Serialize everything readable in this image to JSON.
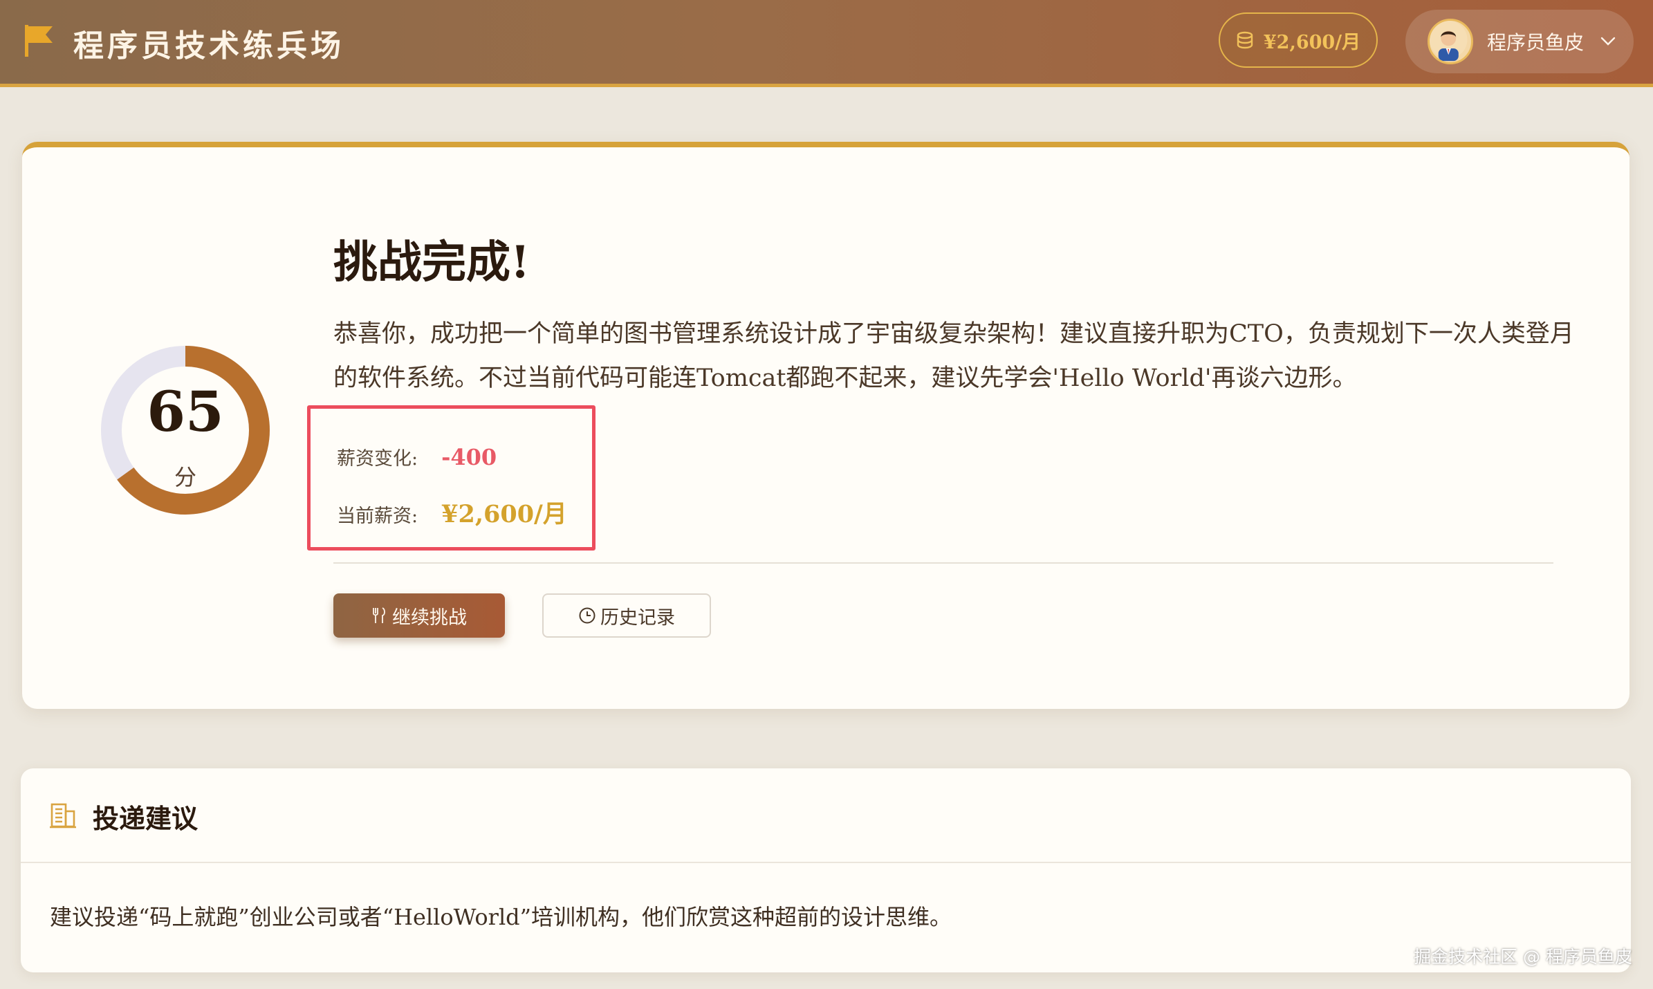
{
  "header": {
    "app_title": "程序员技术练兵场",
    "salary_badge": "¥2,600/月",
    "user_name": "程序员鱼皮",
    "icons": [
      "flag-icon",
      "coins-icon",
      "avatar",
      "chevron-down-icon"
    ]
  },
  "result": {
    "score": "65",
    "score_unit": "分",
    "score_fraction": 0.65,
    "title": "挑战完成!",
    "description": "恭喜你，成功把一个简单的图书管理系统设计成了宇宙级复杂架构！建议直接升职为CTO，负责规划下一次人类登月的软件系统。不过当前代码可能连Tomcat都跑不起来，建议先学会'Hello World'再谈六边形。",
    "salary_change_label": "薪资变化:",
    "salary_change_value": "-400",
    "current_salary_label": "当前薪资:",
    "current_salary_value": "¥2,600/月",
    "continue_button": "继续挑战",
    "history_button": "历史记录"
  },
  "suggestion": {
    "title": "投递建议",
    "text": "建议投递“码上就跑”创业公司或者“HelloWorld”培训机构，他们欣赏这种超前的设计思维。"
  },
  "watermark": "掘金技术社区 @ 程序员鱼皮",
  "colors": {
    "accent_gold": "#d6a23a",
    "header_brown": "#9a6c48",
    "negative_red": "#e85a66",
    "highlight_box": "#ec4d5d",
    "ring_fill": "#b8702e",
    "ring_track": "#e6e4ef"
  }
}
